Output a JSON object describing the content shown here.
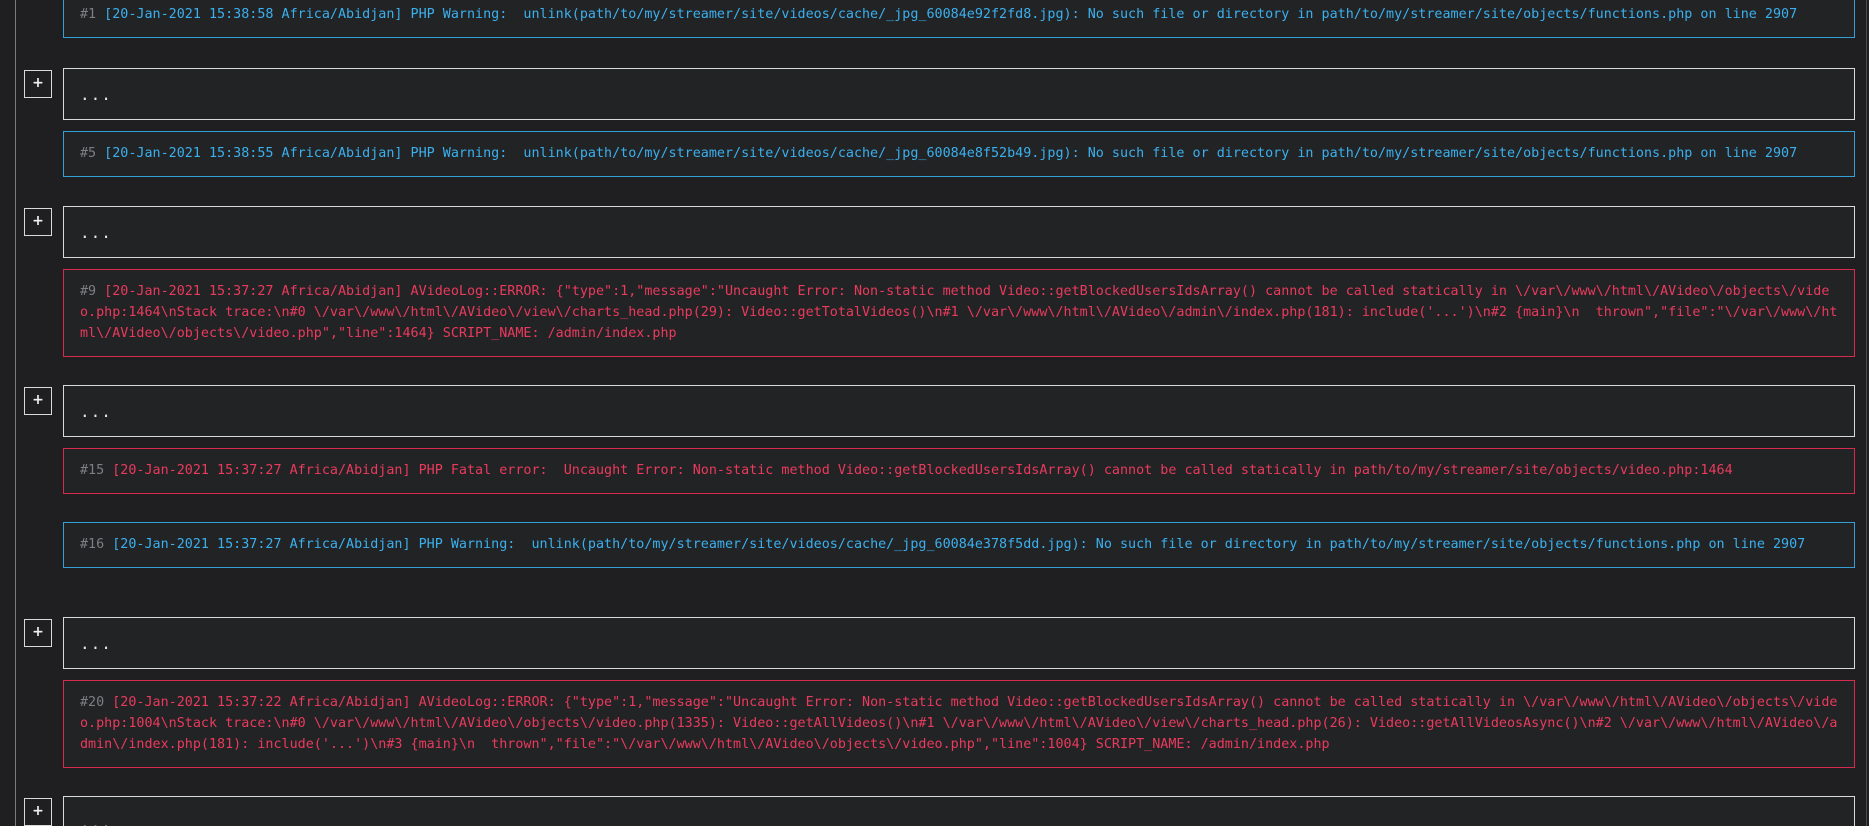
{
  "expand_label": "+",
  "ellipsis": "...",
  "entries": [
    {
      "level": "warning",
      "number": "#1",
      "text": " [20-Jan-2021 15:38:58 Africa/Abidjan] PHP Warning:  unlink(path/to/my/streamer/site/videos/cache/_jpg_60084e92f2fd8.jpg): No such file or directory in path/to/my/streamer/site/objects/functions.php on line 2907"
    },
    {
      "level": "warning",
      "number": "#5",
      "text": " [20-Jan-2021 15:38:55 Africa/Abidjan] PHP Warning:  unlink(path/to/my/streamer/site/videos/cache/_jpg_60084e8f52b49.jpg): No such file or directory in path/to/my/streamer/site/objects/functions.php on line 2907"
    },
    {
      "level": "error",
      "number": "#9",
      "text": " [20-Jan-2021 15:37:27 Africa/Abidjan] AVideoLog::ERROR: {\"type\":1,\"message\":\"Uncaught Error: Non-static method Video::getBlockedUsersIdsArray() cannot be called statically in \\/var\\/www\\/html\\/AVideo\\/objects\\/video.php:1464\\nStack trace:\\n#0 \\/var\\/www\\/html\\/AVideo\\/view\\/charts_head.php(29): Video::getTotalVideos()\\n#1 \\/var\\/www\\/html\\/AVideo\\/admin\\/index.php(181): include('...')\\n#2 {main}\\n  thrown\",\"file\":\"\\/var\\/www\\/html\\/AVideo\\/objects\\/video.php\",\"line\":1464} SCRIPT_NAME: /admin/index.php"
    },
    {
      "level": "error",
      "number": "#15",
      "text": " [20-Jan-2021 15:37:27 Africa/Abidjan] PHP Fatal error:  Uncaught Error: Non-static method Video::getBlockedUsersIdsArray() cannot be called statically in path/to/my/streamer/site/objects/video.php:1464"
    },
    {
      "level": "warning",
      "number": "#16",
      "text": " [20-Jan-2021 15:37:27 Africa/Abidjan] PHP Warning:  unlink(path/to/my/streamer/site/videos/cache/_jpg_60084e378f5dd.jpg): No such file or directory in path/to/my/streamer/site/objects/functions.php on line 2907"
    },
    {
      "level": "error",
      "number": "#20",
      "text": " [20-Jan-2021 15:37:22 Africa/Abidjan] AVideoLog::ERROR: {\"type\":1,\"message\":\"Uncaught Error: Non-static method Video::getBlockedUsersIdsArray() cannot be called statically in \\/var\\/www\\/html\\/AVideo\\/objects\\/video.php:1004\\nStack trace:\\n#0 \\/var\\/www\\/html\\/AVideo\\/objects\\/video.php(1335): Video::getAllVideos()\\n#1 \\/var\\/www\\/html\\/AVideo\\/view\\/charts_head.php(26): Video::getAllVideosAsync()\\n#2 \\/var\\/www\\/html\\/AVideo\\/admin\\/index.php(181): include('...')\\n#3 {main}\\n  thrown\",\"file\":\"\\/var\\/www\\/html\\/AVideo\\/objects\\/video.php\",\"line\":1004} SCRIPT_NAME: /admin/index.php"
    }
  ]
}
